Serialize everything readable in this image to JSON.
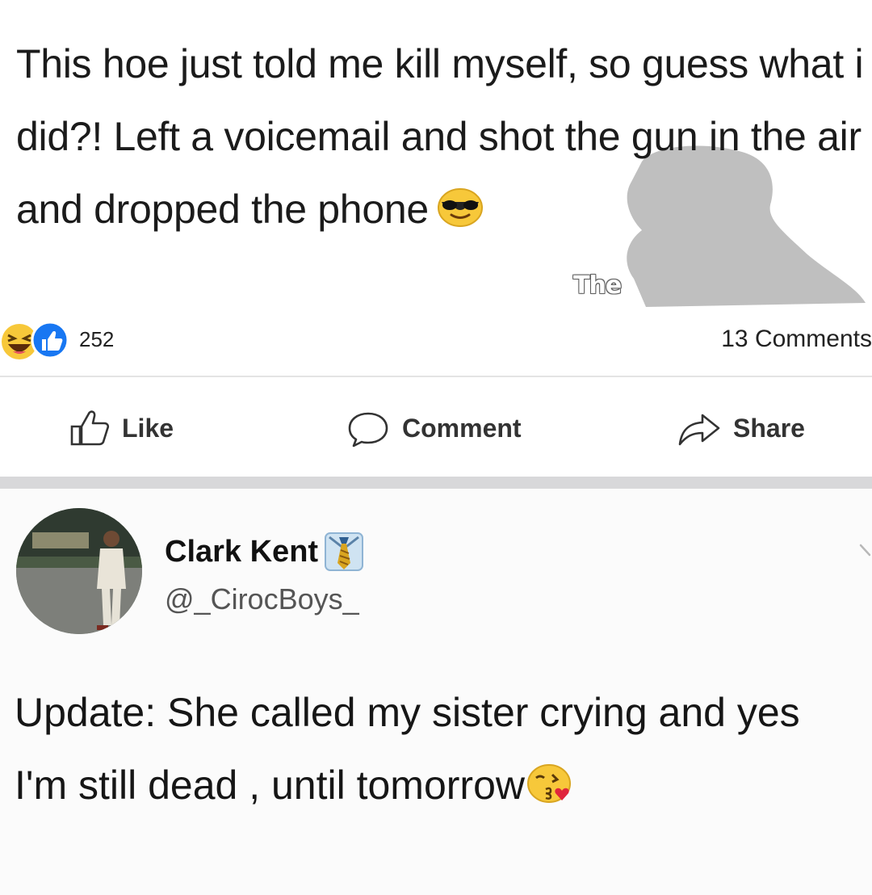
{
  "post1": {
    "text": "This hoe just told me kill myself, so guess what i did?! Left a voicemail and shot the gun in the air and dropped the phone",
    "end_emoji": "smiling-face-with-sunglasses",
    "watermark": "The",
    "reactions": {
      "icons": [
        "laughing-reaction",
        "like-reaction"
      ],
      "count": "252"
    },
    "comments_count": "13 Comments",
    "actions": {
      "like": "Like",
      "comment": "Comment",
      "share": "Share"
    }
  },
  "post2": {
    "author": {
      "name": "Clark Kent",
      "name_emoji": "necktie",
      "handle": "@_CirocBoys_"
    },
    "text": "Update: She called my sister crying and yes I'm still dead , until tomorrow",
    "end_emoji": "face-blowing-kiss"
  },
  "colors": {
    "background": "#ffffff",
    "divider": "#d8d8da",
    "like_blue": "#1877f2",
    "emoji_yellow": "#f7c83a"
  }
}
